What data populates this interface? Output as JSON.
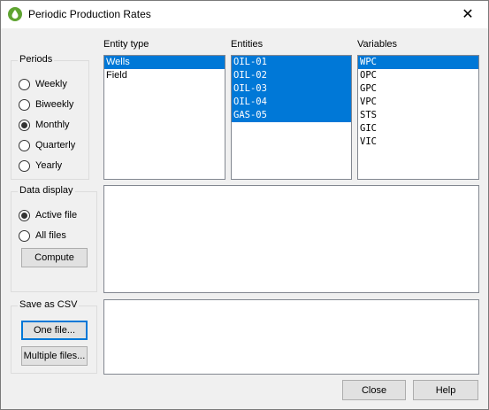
{
  "window": {
    "title": "Periodic Production Rates",
    "close_glyph": "✕",
    "icon": "droplet-icon"
  },
  "periods": {
    "label": "Periods",
    "options": [
      {
        "label": "Weekly",
        "checked": false
      },
      {
        "label": "Biweekly",
        "checked": false
      },
      {
        "label": "Monthly",
        "checked": true
      },
      {
        "label": "Quarterly",
        "checked": false
      },
      {
        "label": "Yearly",
        "checked": false
      }
    ]
  },
  "data_display": {
    "label": "Data display",
    "options": [
      {
        "label": "Active file",
        "checked": true
      },
      {
        "label": "All files",
        "checked": false
      }
    ],
    "compute_label": "Compute"
  },
  "save_csv": {
    "label": "Save as CSV",
    "one_file_label": "One file...",
    "multiple_files_label": "Multiple files..."
  },
  "entity_type": {
    "label": "Entity type",
    "items": [
      {
        "label": "Wells",
        "selected": true
      },
      {
        "label": "Field",
        "selected": false
      }
    ]
  },
  "entities": {
    "label": "Entities",
    "items": [
      {
        "label": "OIL-01",
        "selected": true
      },
      {
        "label": "OIL-02",
        "selected": true
      },
      {
        "label": "OIL-03",
        "selected": true
      },
      {
        "label": "OIL-04",
        "selected": true
      },
      {
        "label": "GAS-05",
        "selected": true
      }
    ]
  },
  "variables": {
    "label": "Variables",
    "items": [
      {
        "label": "WPC",
        "selected": true
      },
      {
        "label": "OPC",
        "selected": false
      },
      {
        "label": "GPC",
        "selected": false
      },
      {
        "label": "VPC",
        "selected": false
      },
      {
        "label": "STS",
        "selected": false
      },
      {
        "label": "GIC",
        "selected": false
      },
      {
        "label": "VIC",
        "selected": false
      }
    ]
  },
  "footer": {
    "close_label": "Close",
    "help_label": "Help"
  },
  "colors": {
    "selection": "#0078d7",
    "icon_green": "#5fa432",
    "default_button_border": "#0078d7"
  }
}
